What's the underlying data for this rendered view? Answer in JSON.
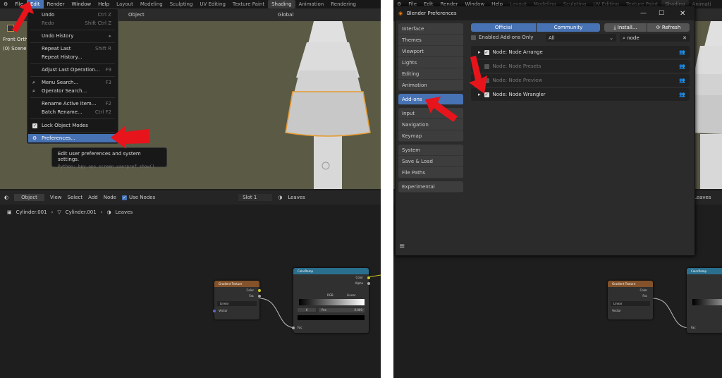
{
  "left": {
    "topmenu": [
      "File",
      "Edit",
      "Render",
      "Window",
      "Help"
    ],
    "workspaces": [
      "Layout",
      "Modeling",
      "Sculpting",
      "UV Editing",
      "Texture Paint",
      "Shading",
      "Animation",
      "Rendering"
    ],
    "active_workspace": "Shading",
    "header": {
      "object_menu": "Object",
      "orientation": "Global"
    },
    "viewport_overlay": [
      "Front Orth",
      "(0) Scene"
    ],
    "edit_menu": [
      {
        "label": "Undo",
        "shortcut": "Ctrl Z"
      },
      {
        "label": "Redo",
        "shortcut": "Shift Ctrl Z",
        "disabled": true
      },
      {
        "label": "Undo History",
        "shortcut": "▸"
      },
      {
        "label": "Repeat Last",
        "shortcut": "Shift R"
      },
      {
        "label": "Repeat History...",
        "shortcut": ""
      },
      {
        "label": "Adjust Last Operation...",
        "shortcut": "F9"
      },
      {
        "label": "Menu Search...",
        "shortcut": "F3",
        "icon": "search"
      },
      {
        "label": "Operator Search...",
        "shortcut": "",
        "icon": "search"
      },
      {
        "label": "Rename Active Item...",
        "shortcut": "F2"
      },
      {
        "label": "Batch Rename...",
        "shortcut": "Ctrl F2"
      },
      {
        "label": "Lock Object Modes",
        "shortcut": "",
        "icon": "checkbox"
      },
      {
        "label": "Preferences...",
        "shortcut": "",
        "icon": "gear",
        "highlighted": true
      }
    ],
    "tooltip": {
      "text": "Edit user preferences and system settings.",
      "python": "Python: bpy.ops.screen.userpref_show()"
    },
    "node_header": {
      "mode": "Object",
      "menus": [
        "View",
        "Select",
        "Add",
        "Node"
      ],
      "use_nodes": "Use Nodes",
      "slot": "Slot 1",
      "material": "Leaves"
    },
    "breadcrumb": [
      "Cylinder.001",
      "Cylinder.001",
      "Leaves"
    ]
  },
  "nodes": {
    "gradient": {
      "title": "Gradient Texture",
      "outputs": [
        "Color",
        "Fac"
      ],
      "type": "Linear",
      "input": "Vector",
      "color": "#83522a"
    },
    "colorramp": {
      "title": "ColorRamp",
      "outputs": [
        "Color",
        "Alpha"
      ],
      "mode": "RGB",
      "interp": "Linear",
      "index": "0",
      "pos_label": "Pos",
      "pos": "0.000",
      "input": "Fac",
      "color": "#2b6f8e"
    }
  },
  "right": {
    "topmenu": [
      "File",
      "Edit",
      "Render",
      "Window",
      "Help"
    ],
    "workspaces": [
      "Layout",
      "Modeling",
      "Sculpting",
      "UV Editing",
      "Texture Paint",
      "Shading",
      "Animati"
    ],
    "prefs": {
      "title": "Blender Preferences",
      "sidebar_groups": [
        [
          "Interface",
          "Themes",
          "Viewport",
          "Lights",
          "Editing",
          "Animation"
        ],
        [
          "Add-ons"
        ],
        [
          "Input",
          "Navigation",
          "Keymap"
        ],
        [
          "System",
          "Save & Load",
          "File Paths"
        ],
        [
          "Experimental"
        ]
      ],
      "active": "Add-ons",
      "tabs": [
        "Official",
        "Community"
      ],
      "install": "Install...",
      "refresh": "Refresh",
      "enabled_only": "Enabled Add-ons Only",
      "category": "All",
      "search": "node",
      "addons": [
        {
          "name": "Node: Node Arrange",
          "enabled": true
        },
        {
          "name": "Node: Node Presets",
          "enabled": false
        },
        {
          "name": "Node: Node Preview",
          "enabled": false
        },
        {
          "name": "Node: Node Wrangler",
          "enabled": true
        }
      ]
    },
    "bg_material": "Leaves"
  },
  "colors": {
    "accent": "#4772b3",
    "arrow": "#e8141b",
    "viewport": "#5b5a45"
  }
}
